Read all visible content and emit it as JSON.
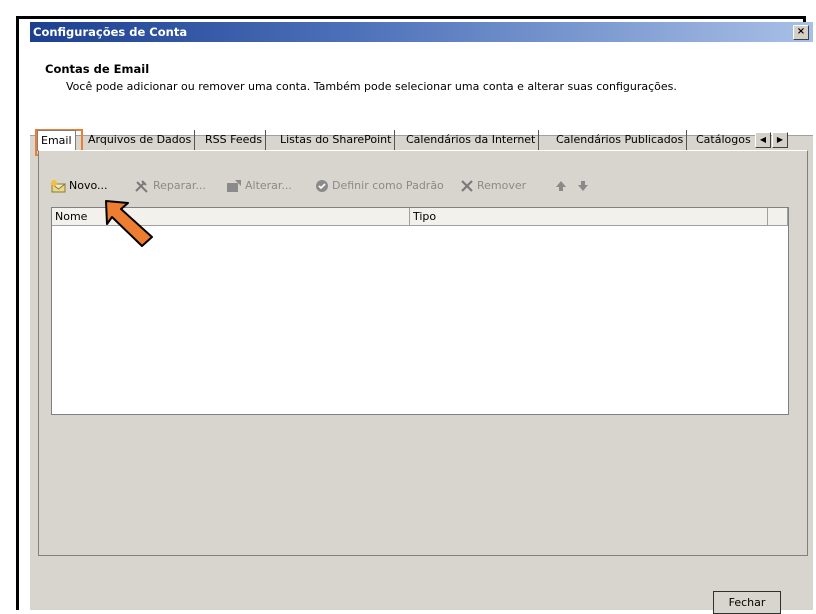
{
  "window": {
    "title": "Configurações de Conta",
    "close_glyph": "×"
  },
  "header": {
    "title": "Contas de Email",
    "description": "Você pode adicionar ou remover uma conta. Também pode selecionar uma conta e alterar suas configurações."
  },
  "tabs": [
    {
      "label": "Email",
      "active": true
    },
    {
      "label": "Arquivos de Dados"
    },
    {
      "label": "RSS Feeds"
    },
    {
      "label": "Listas do SharePoint"
    },
    {
      "label": "Calendários da Internet"
    },
    {
      "label": "Calendários Publicados"
    },
    {
      "label": "Catálogos"
    }
  ],
  "toolbar": {
    "novo": "Novo...",
    "reparar": "Reparar...",
    "alterar": "Alterar...",
    "definir": "Definir como Padrão",
    "remover": "Remover"
  },
  "list": {
    "columns": [
      "Nome",
      "Tipo"
    ],
    "rows": []
  },
  "footer": {
    "close_label": "Fechar"
  },
  "colors": {
    "highlight": "#ed7d31",
    "arrow": "#ed7d31",
    "titlebar": "#1c3f8f"
  }
}
